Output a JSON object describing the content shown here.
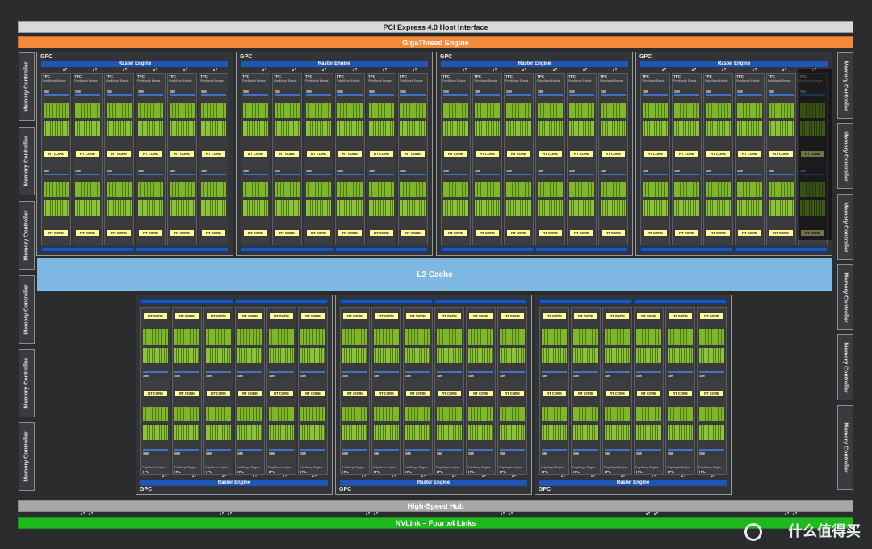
{
  "bars": {
    "pcie": "PCI Express 4.0 Host Interface",
    "giga": "GigaThread Engine",
    "l2": "L2 Cache",
    "hub": "High-Speed Hub",
    "nvlink": "NVLink – Four x4 Links"
  },
  "memory_controller_label": "Memory Controller",
  "gpc": {
    "label": "GPC",
    "raster": "Raster Engine",
    "tpc": "TPC",
    "polymorph": "PolyMorph Engine",
    "sm": "SM",
    "rt": "RT CORE"
  },
  "watermark": "什么值得买",
  "colors": {
    "orange": "#f28a3a",
    "l2": "#7db7e2",
    "green": "#1fb81f",
    "raster": "#1f56b6",
    "rt_core": "#fffb9c",
    "cuda": "#7fb62a"
  }
}
